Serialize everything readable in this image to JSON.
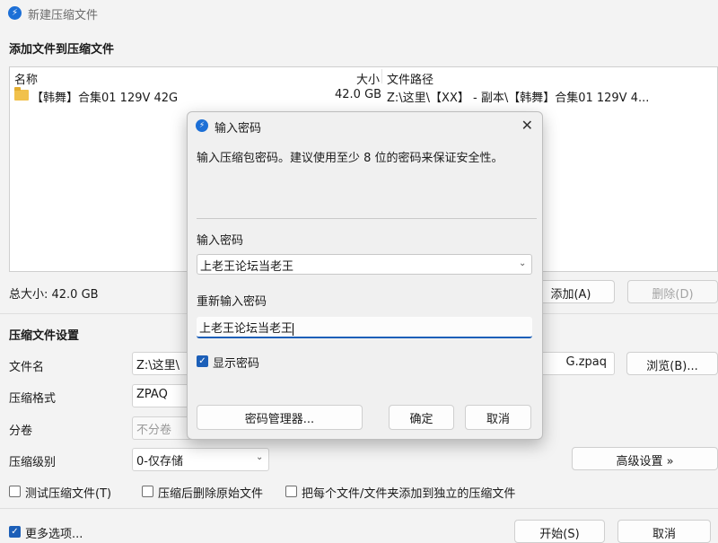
{
  "window": {
    "title": "新建压缩文件",
    "logo_icon": "zip-app-logo"
  },
  "section_add": {
    "heading": "添加文件到压缩文件"
  },
  "file_list": {
    "columns": {
      "name": "名称",
      "size": "大小",
      "path": "文件路径"
    },
    "rows": [
      {
        "name": "【韩舞】合集01 129V 42G",
        "size": "42.0 GB",
        "path": "Z:\\这里\\【XX】 - 副本\\【韩舞】合集01 129V 4..."
      }
    ]
  },
  "summary": {
    "total_size": "总大小: 42.0 GB",
    "add_button": "添加(A)",
    "delete_button": "删除(D)"
  },
  "settings": {
    "heading": "压缩文件设置",
    "filename_label": "文件名",
    "filename_value_left": "Z:\\这里\\【",
    "filename_value_right": "G.zpaq",
    "browse_button": "浏览(B)...",
    "format_label": "压缩格式",
    "format_value": "ZPAQ",
    "split_label": "分卷",
    "split_value": "不分卷",
    "level_label": "压缩级别",
    "level_value": "0-仅存储",
    "advanced_button": "高级设置 »",
    "test_checkbox": "测试压缩文件(T)",
    "delete_after_checkbox": "压缩后删除原始文件",
    "each_separate_checkbox": "把每个文件/文件夹添加到独立的压缩文件"
  },
  "footer": {
    "more_options": "更多选项...",
    "start_button": "开始(S)",
    "cancel_button": "取消"
  },
  "dialog": {
    "title": "输入密码",
    "close_glyph": "✕",
    "description": "输入压缩包密码。建议使用至少 8 位的密码来保证安全性。",
    "password_label": "输入密码",
    "password_value": "上老王论坛当老王",
    "reenter_label": "重新输入密码",
    "reenter_value": "上老王论坛当老王",
    "show_password": "显示密码",
    "manager_button": "密码管理器...",
    "ok_button": "确定",
    "cancel_button": "取消"
  },
  "glyphs": {
    "check": "✓",
    "chevron_down": "⌄"
  },
  "colors": {
    "accent": "#1c5fb8",
    "folder": "#f1c14b",
    "logo": "#1c6fd6"
  }
}
